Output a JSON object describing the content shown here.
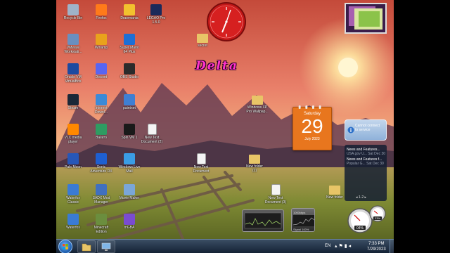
{
  "desktop": {
    "icons": [
      {
        "label": "Recycle Bin",
        "glyph": "recycle-bin-icon",
        "color": "#9fb3c8"
      },
      {
        "label": "Firefox",
        "glyph": "firefox-icon",
        "color": "#ff7a1a"
      },
      {
        "label": "Drawmania",
        "glyph": "drawmania-icon",
        "color": "#f2c12e"
      },
      {
        "label": "LEGAO Pro\n1.5.0",
        "glyph": "legao-icon",
        "color": "#1c2a5a"
      },
      {
        "label": "VMware\nWorkstati...",
        "glyph": "vmware-icon",
        "color": "#6a8fbf"
      },
      {
        "label": "Winamp",
        "glyph": "winamp-icon",
        "color": "#e9a21c"
      },
      {
        "label": "Super Mario\n64 Plus",
        "glyph": "super-mario-icon",
        "color": "#1d6fd6"
      },
      {
        "label": "Oracle VM\nVirtualBox",
        "glyph": "virtualbox-icon",
        "color": "#1d4aa0"
      },
      {
        "label": "Discord",
        "glyph": "discord-icon",
        "color": "#5865f2"
      },
      {
        "label": "OBS Studio",
        "glyph": "obs-studio-icon",
        "color": "#2b2b2b"
      },
      {
        "label": "Steam",
        "glyph": "steam-icon",
        "color": "#1b2838"
      },
      {
        "label": "Internet\nDownl...",
        "glyph": "download-manager-icon",
        "color": "#3b8ad8"
      },
      {
        "label": "paintnet",
        "glyph": "paint-net-icon",
        "color": "#3f7fd3"
      },
      {
        "label": "VLC media\nplayer",
        "glyph": "vlc-icon",
        "color": "#ff8800"
      },
      {
        "label": "Balatro",
        "glyph": "balatro-icon",
        "color": "#2e9c62"
      },
      {
        "label": "Spin VM 1",
        "glyph": "spin-vm-icon",
        "color": "#1a1a1a"
      },
      {
        "label": "New Text\nDocument (2)",
        "glyph": "text-document-icon",
        "color": "#f4f4f4"
      },
      {
        "label": "Pale Moon",
        "glyph": "pale-moon-icon",
        "color": "#2757b8"
      },
      {
        "label": "Sonic\nAdventure DX",
        "glyph": "sonic-icon",
        "color": "#1e5fd1"
      },
      {
        "label": "Windows Live\nMail",
        "glyph": "live-mail-icon",
        "color": "#3a9de6"
      },
      {
        "label": "New Text\nDocument",
        "glyph": "text-document-icon",
        "color": "#f4f4f4"
      },
      {
        "label": "New folder\n(2)",
        "glyph": "folder-icon",
        "color": "#e8c567"
      },
      {
        "label": "Waterfox\nClassic",
        "glyph": "waterfox-icon",
        "color": "#3a7bd5"
      },
      {
        "label": "SADX Mod\nManager",
        "glyph": "sadx-mod-manager-icon",
        "color": "#4070c0"
      },
      {
        "label": "Movie Maker",
        "glyph": "movie-maker-icon",
        "color": "#7aa6d8"
      },
      {
        "label": "New Text\nDocument (3)",
        "glyph": "text-document-icon",
        "color": "#f4f4f4"
      },
      {
        "label": "New folder",
        "glyph": "folder-icon",
        "color": "#e8c567"
      },
      {
        "label": "Waterfox",
        "glyph": "waterfox-icon",
        "color": "#3a7bd5"
      },
      {
        "label": "Minecraft\nEdition",
        "glyph": "minecraft-icon",
        "color": "#6b8e3e"
      },
      {
        "label": "mGBA",
        "glyph": "mgba-icon",
        "color": "#7a4cd1"
      },
      {
        "label": "secret",
        "glyph": "folder-icon",
        "color": "#e8c567"
      },
      {
        "label": "Windows XP\nPro Wallpap...",
        "glyph": "folder-icon",
        "color": "#e8c567"
      }
    ]
  },
  "gadgets": {
    "clock": {
      "label": "clock",
      "color": "#d01818"
    },
    "delta_text": "Delta",
    "calendar": {
      "day": "Saturday",
      "date": "29",
      "month_year": "July 2023"
    },
    "feed": {
      "header": "Cannot connect\nto service",
      "items": [
        {
          "title": "News and Features...",
          "subtitle": "USA.gov U...  Sat Dec 30"
        },
        {
          "title": "News and Features f...",
          "subtitle": "Popular G...  Sat Dec 30"
        }
      ],
      "pager": "◂  1-2  ▸"
    },
    "network": {
      "top": "1000kbps",
      "bottom": "Signal 100%"
    },
    "gauge": {
      "cpu_label": "04%",
      "mem_label": "23%"
    }
  },
  "taskbar": {
    "lang": "EN",
    "time": "7:33 PM",
    "date": "7/29/2023"
  },
  "colors": {
    "sky_top": "#d3624c",
    "sun": "#fff4c0",
    "grass": "#8a8a2a"
  }
}
